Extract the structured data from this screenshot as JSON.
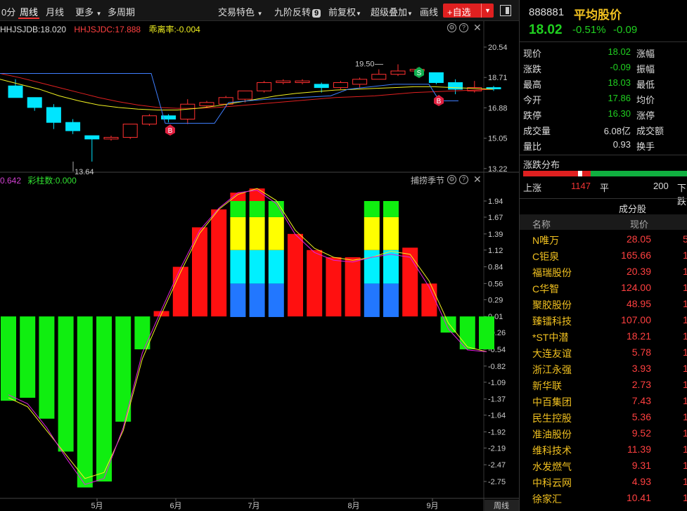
{
  "toolbar": {
    "items": [
      "0分",
      "周线",
      "月线",
      "更多",
      "多周期",
      "交易特色",
      "九阶反转",
      "前复权",
      "超级叠加",
      "画线"
    ],
    "active": "周线",
    "badge": "9",
    "add_label": "+自选"
  },
  "main_chart": {
    "legend": {
      "db": "HHJSJDB:18.020",
      "dc": "HHJSJDC:17.888",
      "dev": "乖离率:-0.004"
    },
    "y_ticks": [
      "20.54",
      "18.71",
      "16.88",
      "15.05",
      "13.22"
    ],
    "high_label": "19.50",
    "low_label": "13.64",
    "signals": {
      "buy": "B",
      "sell": "S"
    },
    "colors": {
      "up": "#ff3030",
      "down": "#00e5ff",
      "blue": "#3f7fff",
      "red": "#e02020",
      "yellow": "#f0f020"
    }
  },
  "indicator": {
    "legend_left": "0.642",
    "legend_mid": "彩柱数:0.000",
    "title": "捕捞季节",
    "y_ticks": [
      "1.94",
      "1.67",
      "1.39",
      "1.12",
      "0.84",
      "0.56",
      "0.29",
      "0.01",
      "-0.26",
      "-0.54",
      "-0.82",
      "-1.09",
      "-1.37",
      "-1.64",
      "-1.92",
      "-2.19",
      "-2.47",
      "-2.75"
    ]
  },
  "x_axis": {
    "months": [
      "5月",
      "6月",
      "7月",
      "8月",
      "9月"
    ],
    "period": "周线"
  },
  "quote": {
    "code": "888881",
    "name": "平均股价",
    "price": "18.02",
    "pct": "-0.51%",
    "chg": "-0.09",
    "rows": [
      {
        "l": "现价",
        "v": "18.02",
        "r": "涨幅"
      },
      {
        "l": "涨跌",
        "v": "-0.09",
        "r": "振幅"
      },
      {
        "l": "最高",
        "v": "18.03",
        "r": "最低"
      },
      {
        "l": "今开",
        "v": "17.86",
        "r": "均价"
      },
      {
        "l": "跌停",
        "v": "16.30",
        "r": "涨停"
      },
      {
        "l": "成交量",
        "v": "6.08亿",
        "r": "成交额"
      },
      {
        "l": "量比",
        "v": "0.93",
        "r": "换手"
      }
    ]
  },
  "distribution": {
    "title": "涨跌分布",
    "up_label": "上涨",
    "up_count": "1147",
    "flat_label": "平",
    "flat_count": "200",
    "down_label": "下跌"
  },
  "components": {
    "title": "成分股",
    "col_name": "名称",
    "col_price": "现价",
    "rows": [
      {
        "name": "N唯万",
        "price": "28.05",
        "extra": "5"
      },
      {
        "name": "C钜泉",
        "price": "165.66",
        "extra": "1"
      },
      {
        "name": "福瑞股份",
        "price": "20.39",
        "extra": "1"
      },
      {
        "name": "C华智",
        "price": "124.00",
        "extra": "1"
      },
      {
        "name": "聚胶股份",
        "price": "48.95",
        "extra": "1"
      },
      {
        "name": "臻镭科技",
        "price": "107.00",
        "extra": "1"
      },
      {
        "name": "*ST中潜",
        "price": "18.21",
        "extra": "1"
      },
      {
        "name": "大连友谊",
        "price": "5.78",
        "extra": "1"
      },
      {
        "name": "浙江永强",
        "price": "3.93",
        "extra": "1"
      },
      {
        "name": "新华联",
        "price": "2.73",
        "extra": "1"
      },
      {
        "name": "中百集团",
        "price": "7.43",
        "extra": "1"
      },
      {
        "name": "民生控股",
        "price": "5.36",
        "extra": "1"
      },
      {
        "name": "准油股份",
        "price": "9.52",
        "extra": "1"
      },
      {
        "name": "维科技术",
        "price": "11.39",
        "extra": "1"
      },
      {
        "name": "水发燃气",
        "price": "9.31",
        "extra": "1"
      },
      {
        "name": "中科云网",
        "price": "4.93",
        "extra": "1"
      },
      {
        "name": "徐家汇",
        "price": "10.41",
        "extra": "1"
      }
    ]
  }
}
